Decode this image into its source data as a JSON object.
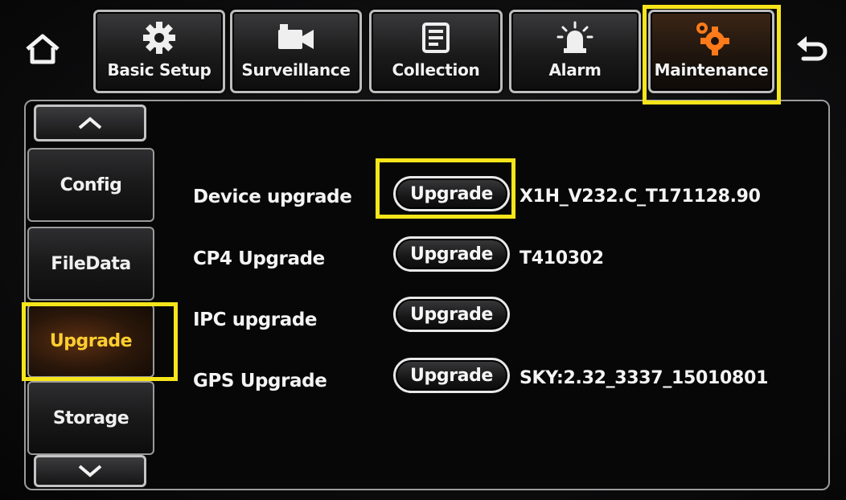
{
  "header": {
    "home_icon": "home-icon",
    "back_icon": "back-arrow-icon",
    "tabs": [
      {
        "label": "Basic Setup",
        "icon": "gear-icon",
        "active": false
      },
      {
        "label": "Surveillance",
        "icon": "video-camera-icon",
        "active": false
      },
      {
        "label": "Collection",
        "icon": "document-icon",
        "active": false
      },
      {
        "label": "Alarm",
        "icon": "alarm-light-icon",
        "active": false
      },
      {
        "label": "Maintenance",
        "icon": "maintenance-gears-icon",
        "active": true
      }
    ]
  },
  "sidebar": {
    "items": [
      {
        "label": "Config"
      },
      {
        "label": "FileData"
      },
      {
        "label": "Upgrade"
      },
      {
        "label": "Storage"
      }
    ],
    "selected": "Upgrade"
  },
  "upgrade": {
    "rows": [
      {
        "label": "Device upgrade",
        "button": "Upgrade",
        "version": "X1H_V232.C_T171128.90"
      },
      {
        "label": "CP4 Upgrade",
        "button": "Upgrade",
        "version": "T410302"
      },
      {
        "label": "IPC upgrade",
        "button": "Upgrade",
        "version": ""
      },
      {
        "label": "GPS Upgrade",
        "button": "Upgrade",
        "version": "SKY:2.32_3337_15010801"
      }
    ]
  },
  "colors": {
    "highlight": "#f6e51a",
    "active_label": "#ffcf2e",
    "accent_orange": "#ff7a1a"
  }
}
